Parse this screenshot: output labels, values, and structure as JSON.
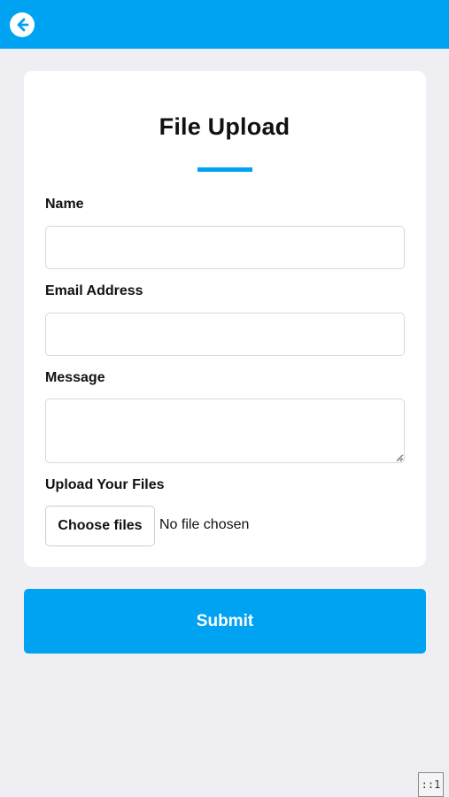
{
  "header": {
    "back_icon": "back-arrow-icon",
    "bar_color": "#00a2f2"
  },
  "form": {
    "title": "File Upload",
    "accent_color": "#00a2f2",
    "name_label": "Name",
    "name_value": "",
    "email_label": "Email Address",
    "email_value": "",
    "message_label": "Message",
    "message_value": "",
    "upload_label": "Upload Your Files",
    "choose_files_label": "Choose files",
    "no_file_text": "No file chosen"
  },
  "submit_label": "Submit",
  "corner_tag": "::1"
}
